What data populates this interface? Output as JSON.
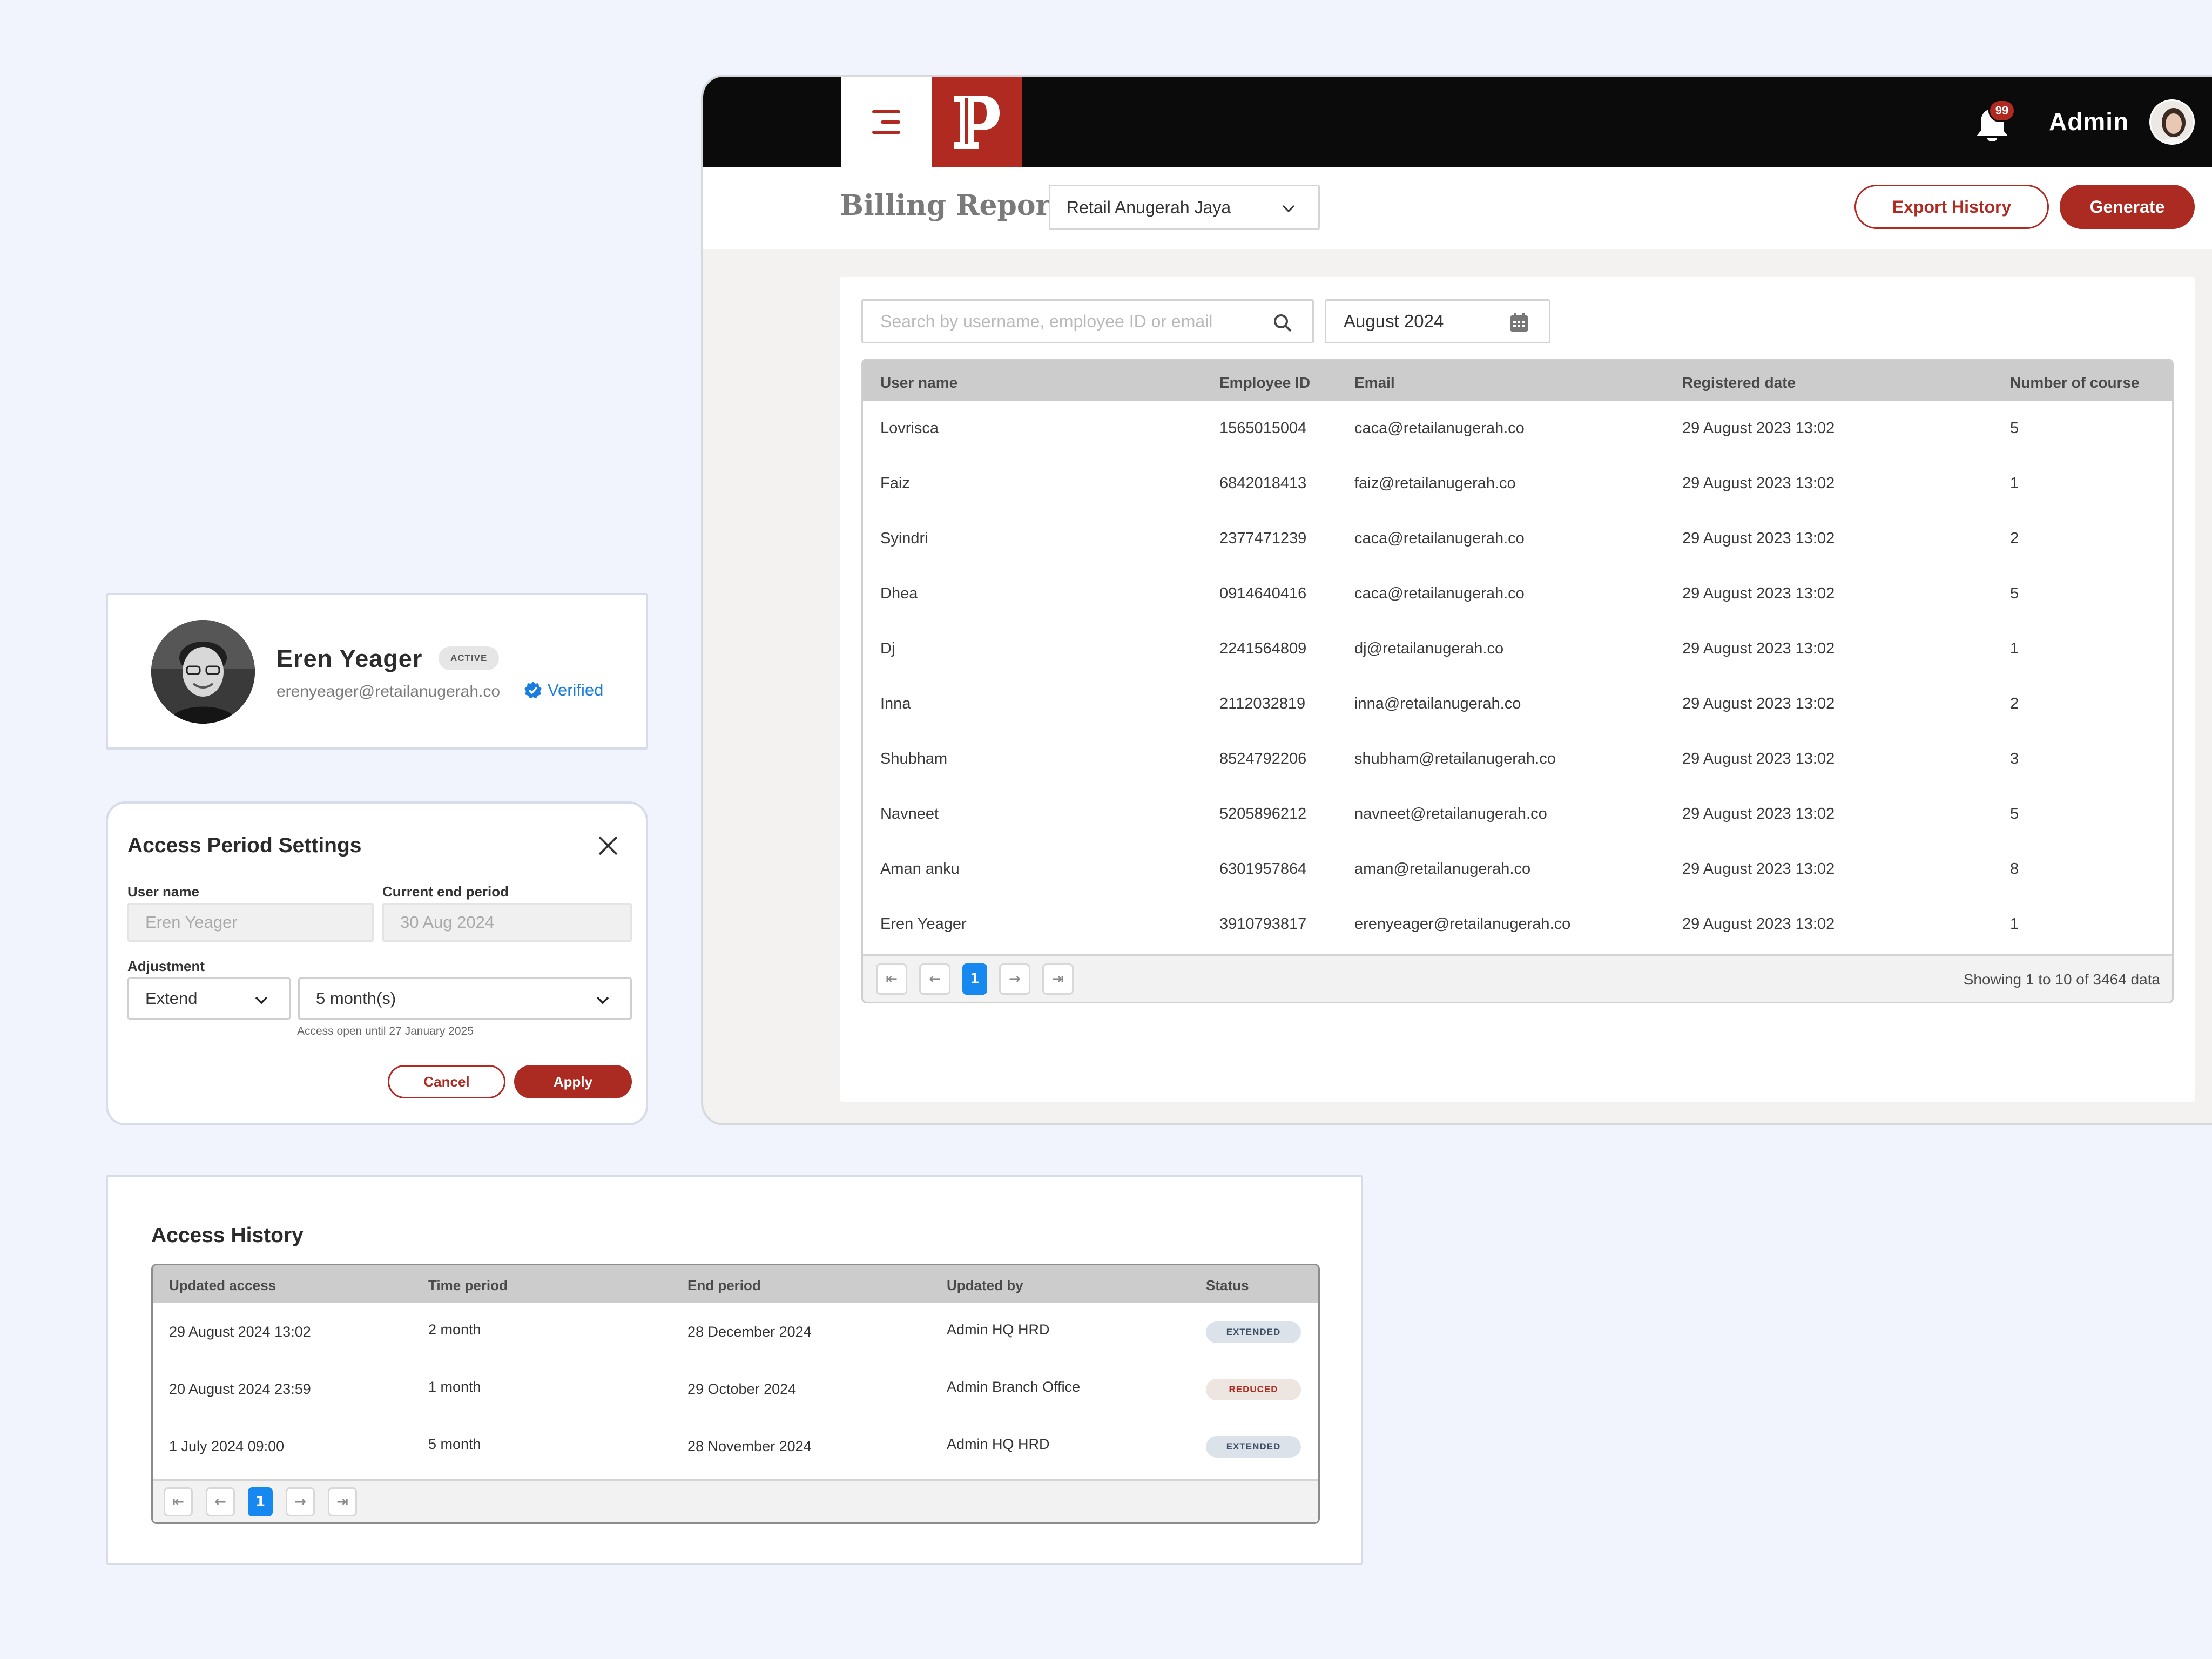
{
  "app": {
    "notifications_count": "99",
    "admin_name": "Admin",
    "page_title": "Billing Report",
    "company_select": "Retail Anugerah Jaya",
    "export_history_label": "Export History",
    "generate_label": "Generate",
    "search_placeholder": "Search by username, employee ID or email",
    "date_filter": "August 2024",
    "columns": [
      "User name",
      "Employee ID",
      "Email",
      "Registered date",
      "Number of course"
    ],
    "rows": [
      [
        "Lovrisca",
        "1565015004",
        "caca@retailanugerah.co",
        "29 August 2023 13:02",
        "5"
      ],
      [
        "Faiz",
        "6842018413",
        "faiz@retailanugerah.co",
        "29 August 2023 13:02",
        "1"
      ],
      [
        "Syindri",
        "2377471239",
        "caca@retailanugerah.co",
        "29 August 2023 13:02",
        "2"
      ],
      [
        "Dhea",
        "0914640416",
        "caca@retailanugerah.co",
        "29 August 2023 13:02",
        "5"
      ],
      [
        "Dj",
        "2241564809",
        "dj@retailanugerah.co",
        "29 August 2023 13:02",
        "1"
      ],
      [
        "Inna",
        "2112032819",
        "inna@retailanugerah.co",
        "29 August 2023 13:02",
        "2"
      ],
      [
        "Shubham",
        "8524792206",
        "shubham@retailanugerah.co",
        "29 August 2023 13:02",
        "3"
      ],
      [
        "Navneet",
        "5205896212",
        "navneet@retailanugerah.co",
        "29 August 2023 13:02",
        "5"
      ],
      [
        "Aman anku",
        "6301957864",
        "aman@retailanugerah.co",
        "29 August 2023 13:02",
        "8"
      ],
      [
        "Eren Yeager",
        "3910793817",
        "erenyeager@retailanugerah.co",
        "29 August 2023 13:02",
        "1"
      ]
    ],
    "pagination": {
      "current_page": "1",
      "showing_text": "Showing 1 to 10 of  3464 data"
    }
  },
  "profile": {
    "name": "Eren Yeager",
    "status_badge": "ACTIVE",
    "email": "erenyeager@retailanugerah.co",
    "verified_label": "Verified"
  },
  "access_period": {
    "title": "Access Period Settings",
    "user_name_label": "User name",
    "user_name_value": "Eren Yeager",
    "current_end_label": "Current end period",
    "current_end_value": "30 Aug 2024",
    "adjustment_label": "Adjustment",
    "adjustment_type": "Extend",
    "adjustment_amount": "5 month(s)",
    "hint": "Access open until 27 January 2025",
    "cancel_label": "Cancel",
    "apply_label": "Apply"
  },
  "access_history": {
    "title": "Access History",
    "columns": [
      "Updated access",
      "Time period",
      "End period",
      "Updated by",
      "Status"
    ],
    "rows": [
      {
        "updated": "29 August 2024 13:02",
        "period": "2 month",
        "end": "28 December 2024",
        "by": "Admin HQ HRD",
        "status": "EXTENDED"
      },
      {
        "updated": "20 August 2024 23:59",
        "period": "1 month",
        "end": "29 October 2024",
        "by": "Admin Branch Office",
        "status": "REDUCED"
      },
      {
        "updated": "1 July 2024 09:00",
        "period": "5 month",
        "end": "28 November 2024",
        "by": "Admin HQ HRD",
        "status": "EXTENDED"
      }
    ],
    "current_page": "1"
  },
  "colors": {
    "brand_red": "#b02a22",
    "topbar_black": "#0b0b0b",
    "page_active_blue": "#1688f0",
    "verified_blue": "#1a7ee0"
  },
  "icons": [
    "menu-icon",
    "logo-p-icon",
    "bell-icon",
    "chevron-down-icon",
    "search-icon",
    "calendar-icon",
    "first-page-icon",
    "prev-page-icon",
    "next-page-icon",
    "last-page-icon",
    "verified-badge-icon",
    "close-icon"
  ]
}
